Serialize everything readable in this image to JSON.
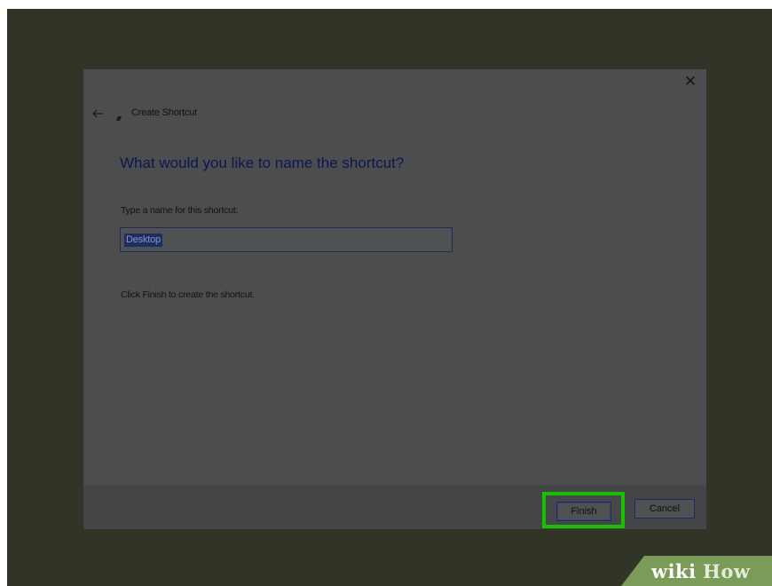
{
  "dialog": {
    "title": "Create Shortcut",
    "close_icon": "close-icon",
    "back_icon": "back-arrow-icon",
    "heading": "What would you like to name the shortcut?",
    "field_label": "Type a name for this shortcut:",
    "name_value": "Desktop",
    "instruction": "Click Finish to create the shortcut.",
    "finish_label": "Finish",
    "cancel_label": "Cancel",
    "highlight_color": "#16c100"
  },
  "watermark": {
    "wiki": "wiki",
    "how": "How"
  }
}
